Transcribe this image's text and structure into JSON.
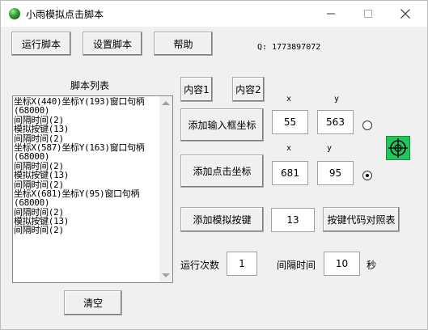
{
  "window": {
    "title": "小雨模拟点击脚本"
  },
  "toolbar": {
    "run_label": "运行脚本",
    "settings_label": "设置脚本",
    "help_label": "帮助",
    "qq_text": "Q: 1773897072"
  },
  "script_list": {
    "heading": "脚本列表",
    "lines": [
      "坐标X(440)坐标Y(193)窗口句柄",
      "(68000)",
      "间隔时间(2)",
      "模拟按键(13)",
      "间隔时间(2)",
      "坐标X(587)坐标Y(163)窗口句柄",
      "(68000)",
      "间隔时间(2)",
      "模拟按键(13)",
      "间隔时间(2)",
      "坐标X(681)坐标Y(95)窗口句柄",
      "(68000)",
      "间隔时间(2)",
      "模拟按键(13)",
      "间隔时间(2)"
    ],
    "clear_label": "清空"
  },
  "content_tabs": {
    "content1_label": "内容1",
    "content2_label": "内容2"
  },
  "input_coord": {
    "button_label": "添加输入框坐标",
    "x_label": "x",
    "y_label": "y",
    "x_value": "55",
    "y_value": "563"
  },
  "click_coord": {
    "button_label": "添加点击坐标",
    "x_label": "x",
    "y_label": "y",
    "x_value": "681",
    "y_value": "95"
  },
  "key_sim": {
    "button_label": "添加模拟按键",
    "key_value": "13",
    "keycode_table_label": "按键代码对照表"
  },
  "run_settings": {
    "count_label": "运行次数",
    "count_value": "1",
    "interval_label": "间隔时间",
    "interval_value": "10",
    "seconds_label": "秒"
  },
  "colors": {
    "crosshair_bg": "#22c55e"
  }
}
